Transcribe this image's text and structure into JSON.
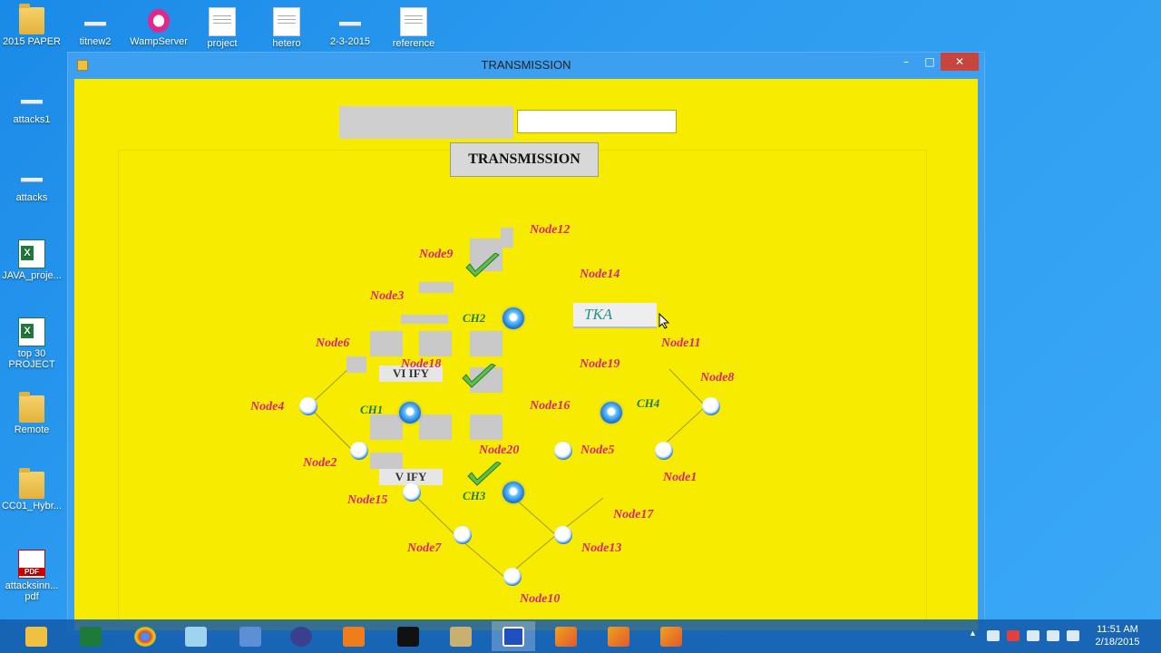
{
  "desktop": {
    "icons_top": [
      {
        "label": "2015 PAPER",
        "type": "folder"
      },
      {
        "label": "titnew2",
        "type": "bar"
      },
      {
        "label": "WampServer",
        "type": "wamp"
      },
      {
        "label": "project",
        "type": "doc"
      },
      {
        "label": "hetero",
        "type": "doc"
      },
      {
        "label": "2-3-2015",
        "type": "bar"
      },
      {
        "label": "reference",
        "type": "doc"
      }
    ],
    "icons_left": [
      {
        "label": "attacks1",
        "type": "bar"
      },
      {
        "label": "attacks",
        "type": "bar"
      },
      {
        "label": "JAVA_proje...",
        "type": "xls"
      },
      {
        "label": "top 30 PROJECT",
        "type": "xls"
      },
      {
        "label": "Remote",
        "type": "folder"
      },
      {
        "label": "CC01_Hybr...",
        "type": "folder"
      },
      {
        "label": "attacksinn... pdf",
        "type": "pdf"
      }
    ]
  },
  "window": {
    "title": "TRANSMISSION",
    "controls": {
      "minimize": "–",
      "maximize": "□",
      "close": "✕"
    },
    "transmission_button": "TRANSMISSION",
    "input_value": "",
    "tka_label": "TKA",
    "verify_label_1": "VI IFY",
    "verify_label_2": "V IFY",
    "colors": {
      "client_bg": "#f7ec00",
      "node_label": "#d8247a",
      "ch_label": "#1f7a5a",
      "close_btn": "#c7453c"
    },
    "nodes": {
      "node12": "Node12",
      "node9": "Node9",
      "node14": "Node14",
      "node3": "Node3",
      "node11": "Node11",
      "node6": "Node6",
      "node18": "Node18",
      "node19": "Node19",
      "node8": "Node8",
      "node4": "Node4",
      "node16": "Node16",
      "node2": "Node2",
      "node20": "Node20",
      "node5": "Node5",
      "node1": "Node1",
      "node15": "Node15",
      "node17": "Node17",
      "node7": "Node7",
      "node13": "Node13",
      "node10": "Node10"
    },
    "cluster_heads": {
      "ch1": "CH1",
      "ch2": "CH2",
      "ch3": "CH3",
      "ch4": "CH4"
    }
  },
  "taskbar": {
    "apps": [
      "file-explorer-icon",
      "excel-icon",
      "chrome-icon",
      "notepad-icon",
      "control-panel-icon",
      "eclipse-icon",
      "media-player-icon",
      "cmd-icon",
      "tools-icon",
      "java-app-icon",
      "java-window-icon",
      "java-window-icon",
      "java-window-icon"
    ],
    "time": "11:51 AM",
    "date": "2/18/2015"
  }
}
